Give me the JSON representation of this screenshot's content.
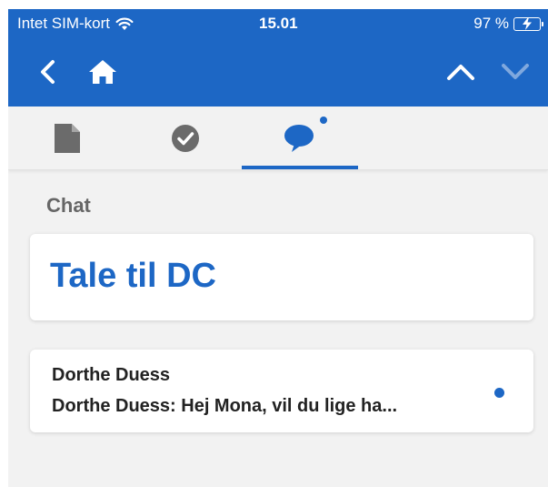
{
  "status_bar": {
    "carrier": "Intet SIM-kort",
    "time": "15.01",
    "battery": "97 %"
  },
  "nav": {
    "back_icon": "chevron-left-icon",
    "home_icon": "home-icon",
    "up_icon": "chevron-up-icon",
    "down_icon": "chevron-down-icon"
  },
  "tabs": [
    {
      "icon": "document-icon",
      "active": false
    },
    {
      "icon": "check-circle-icon",
      "active": false
    },
    {
      "icon": "chat-bubble-icon",
      "active": true,
      "unread": true
    }
  ],
  "chat": {
    "section_title": "Chat",
    "room_title": "Tale til DC",
    "messages": [
      {
        "sender": "Dorthe Duess",
        "preview": "Dorthe Duess: Hej Mona, vil du lige ha...",
        "unread": true
      }
    ]
  },
  "colors": {
    "brand": "#1d67c5",
    "background": "#f2f2f2",
    "battery_fill": "#62d44a"
  }
}
